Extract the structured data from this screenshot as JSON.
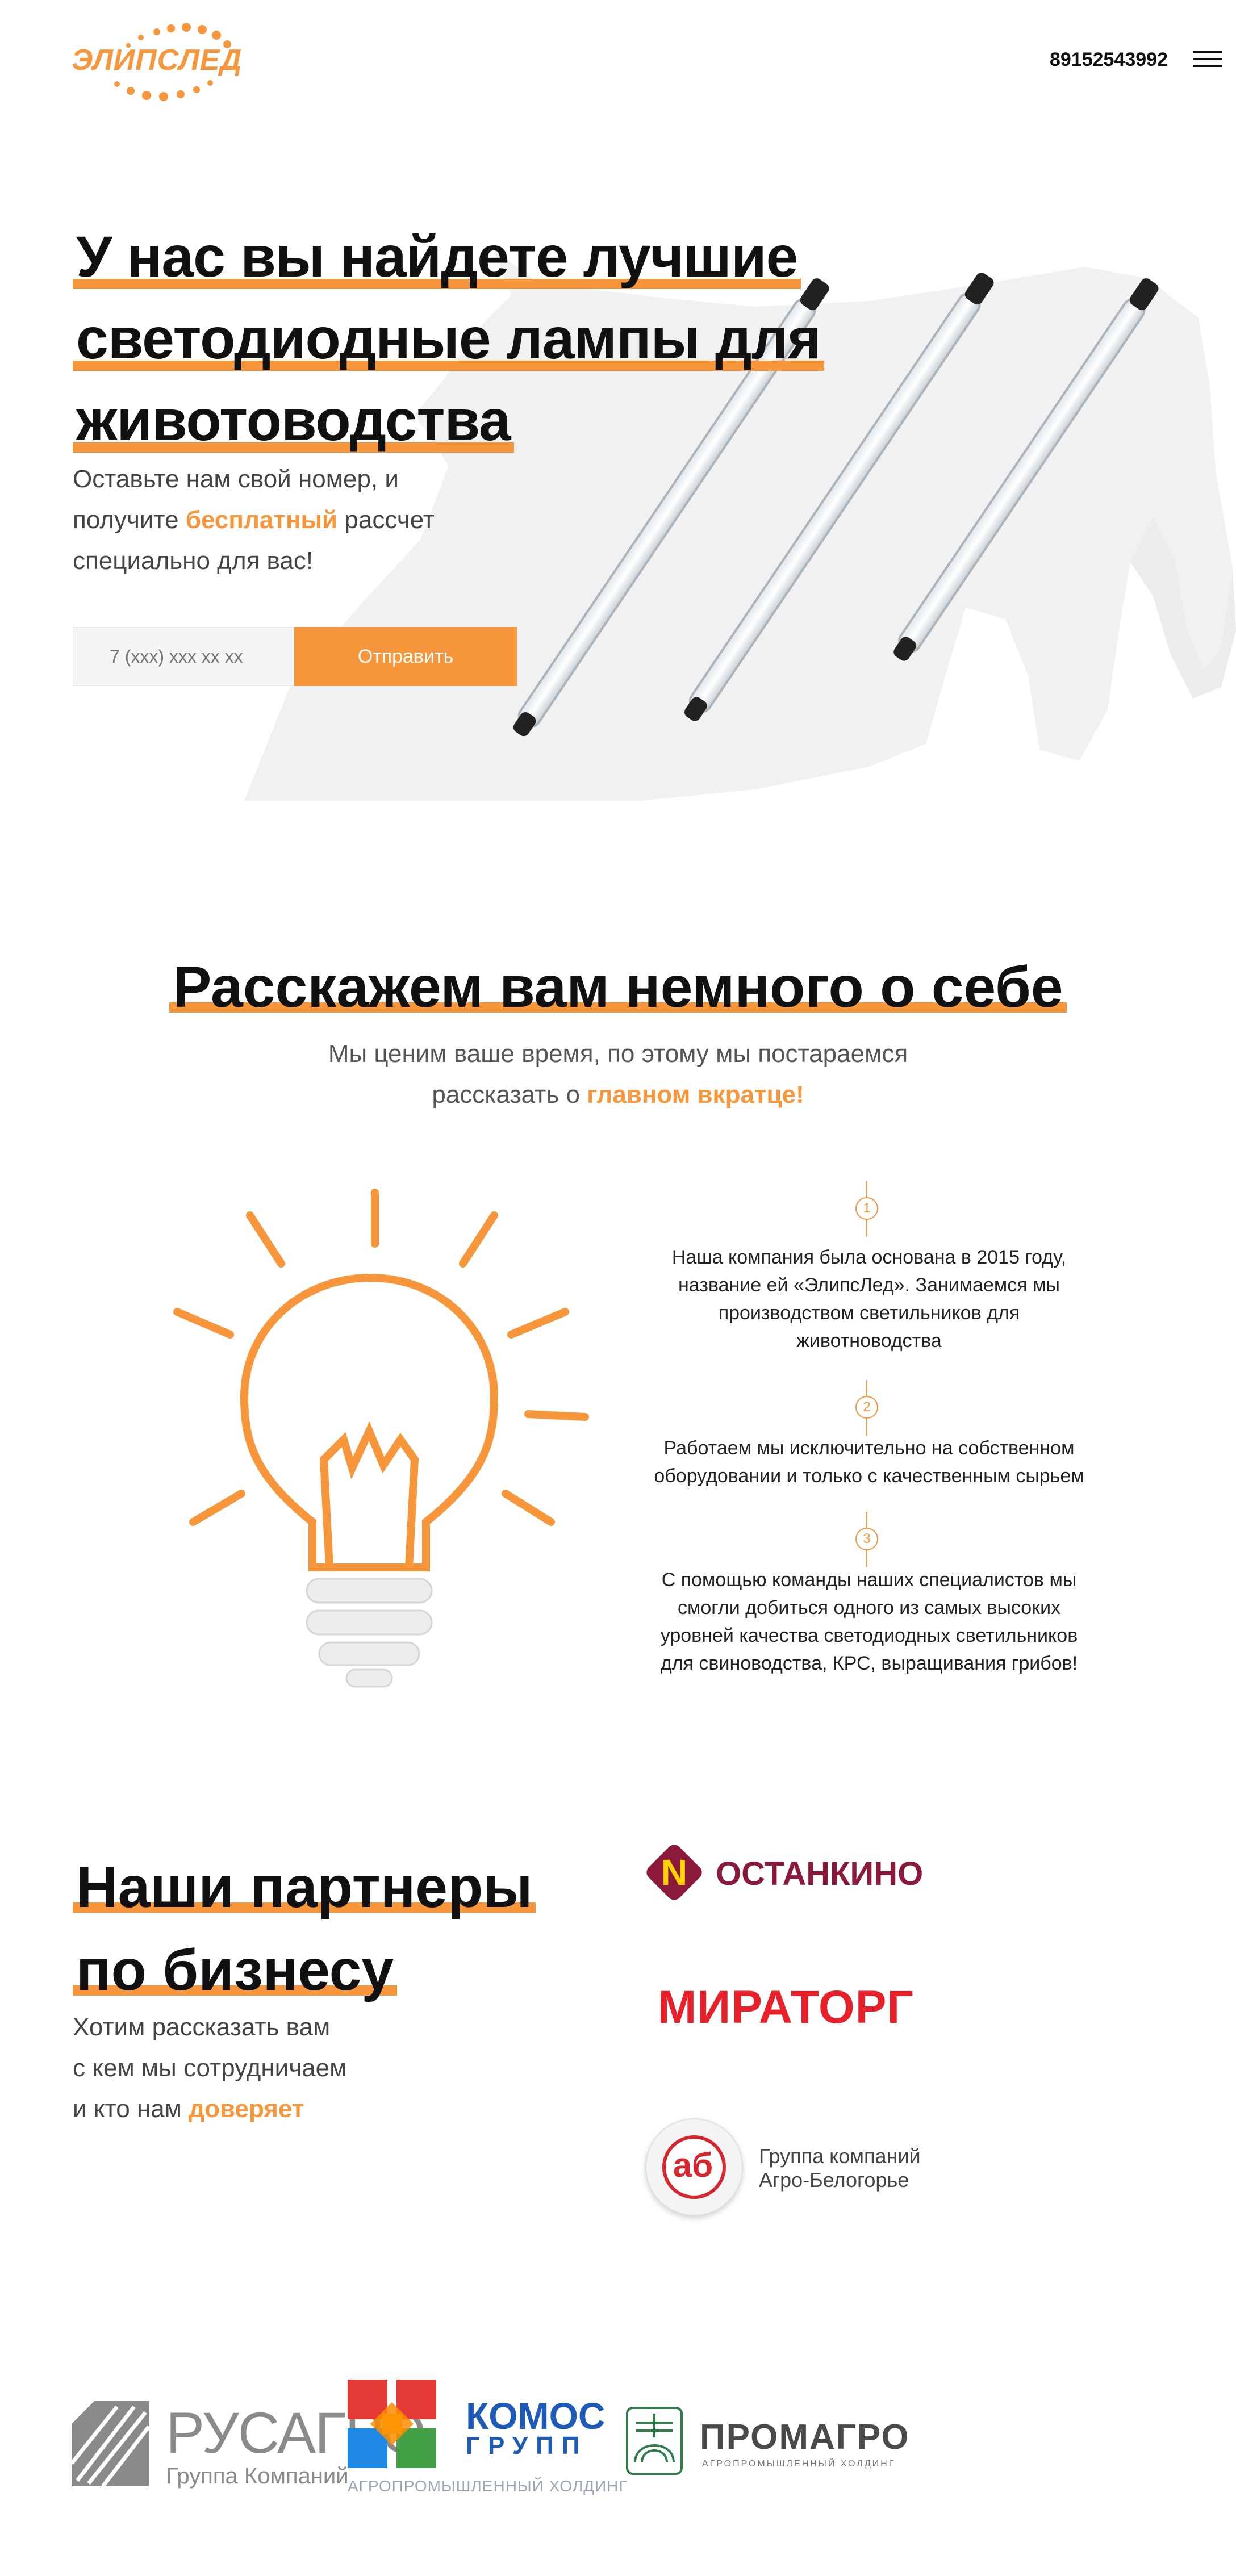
{
  "header": {
    "logo_text": "ЭЛИПСЛЕД",
    "phone": "89152543992",
    "menu_icon": "hamburger-icon"
  },
  "hero": {
    "title_lines": [
      "У нас вы найдете лучшие",
      "светодиодные лампы для",
      "животоводства"
    ],
    "sub_before": "Оставьте нам свой номер, и",
    "sub_line2_before": "получите ",
    "sub_highlight": "бесплатный",
    "sub_line2_after": " рассчет",
    "sub_line3": "специально для вас!",
    "phone_placeholder": "7 (xxx) xxx xx xx",
    "submit_label": "Отправить"
  },
  "about": {
    "title": "Расскажем вам немного о себе",
    "sub_line1": "Мы ценим ваше время, по этому мы постараемся",
    "sub_line2_before": "рассказать о ",
    "sub_highlight": "главном вкратце!",
    "steps": [
      {
        "num": "1",
        "lines": [
          "Наша компания была основана в 2015 году,",
          "название ей «ЭлипсЛед». Занимаемся мы",
          "производством светильников для",
          "животноводства"
        ]
      },
      {
        "num": "2",
        "lines": [
          "Работаем мы исключительно на собственном",
          "оборудовании и только с качественным сырьем"
        ]
      },
      {
        "num": "3",
        "lines": [
          "С помощью команды наших специалистов мы",
          "смогли добиться одного из самых высоких",
          "уровней качества светодиодных светильников",
          "для свиноводства, КРС, выращивания грибов!"
        ]
      }
    ]
  },
  "partners": {
    "title_lines": [
      "Наши партнеры",
      "по бизнесу"
    ],
    "sub_line1": "Хотим рассказать вам",
    "sub_line2": "с кем мы сотрудничаем",
    "sub_line3_before": "и кто нам ",
    "sub_highlight": "доверяет",
    "logos": {
      "ostankino": "ОСТАНКИНО",
      "ostankino_mark": "N",
      "miratorg": "МИРАТОРГ",
      "agro_mark": "аб",
      "agro_line1": "Группа компаний",
      "agro_line2": "Агро-Белогорье",
      "rusagro": "РУСАГРО",
      "rusagro_sub": "Группа Компаний",
      "komos": "КОМОС",
      "komos_group": "ГРУПП",
      "komos_sub": "АГРОПРОМЫШЛЕННЫЙ ХОЛДИНГ",
      "promagro": "ПРОМАГРО",
      "promagro_sub": "АГРОПРОМЫШЛЕННЫЙ ХОЛДИНГ"
    }
  },
  "colors": {
    "accent": "#f7963a",
    "text": "#111111",
    "muted": "#555555"
  }
}
